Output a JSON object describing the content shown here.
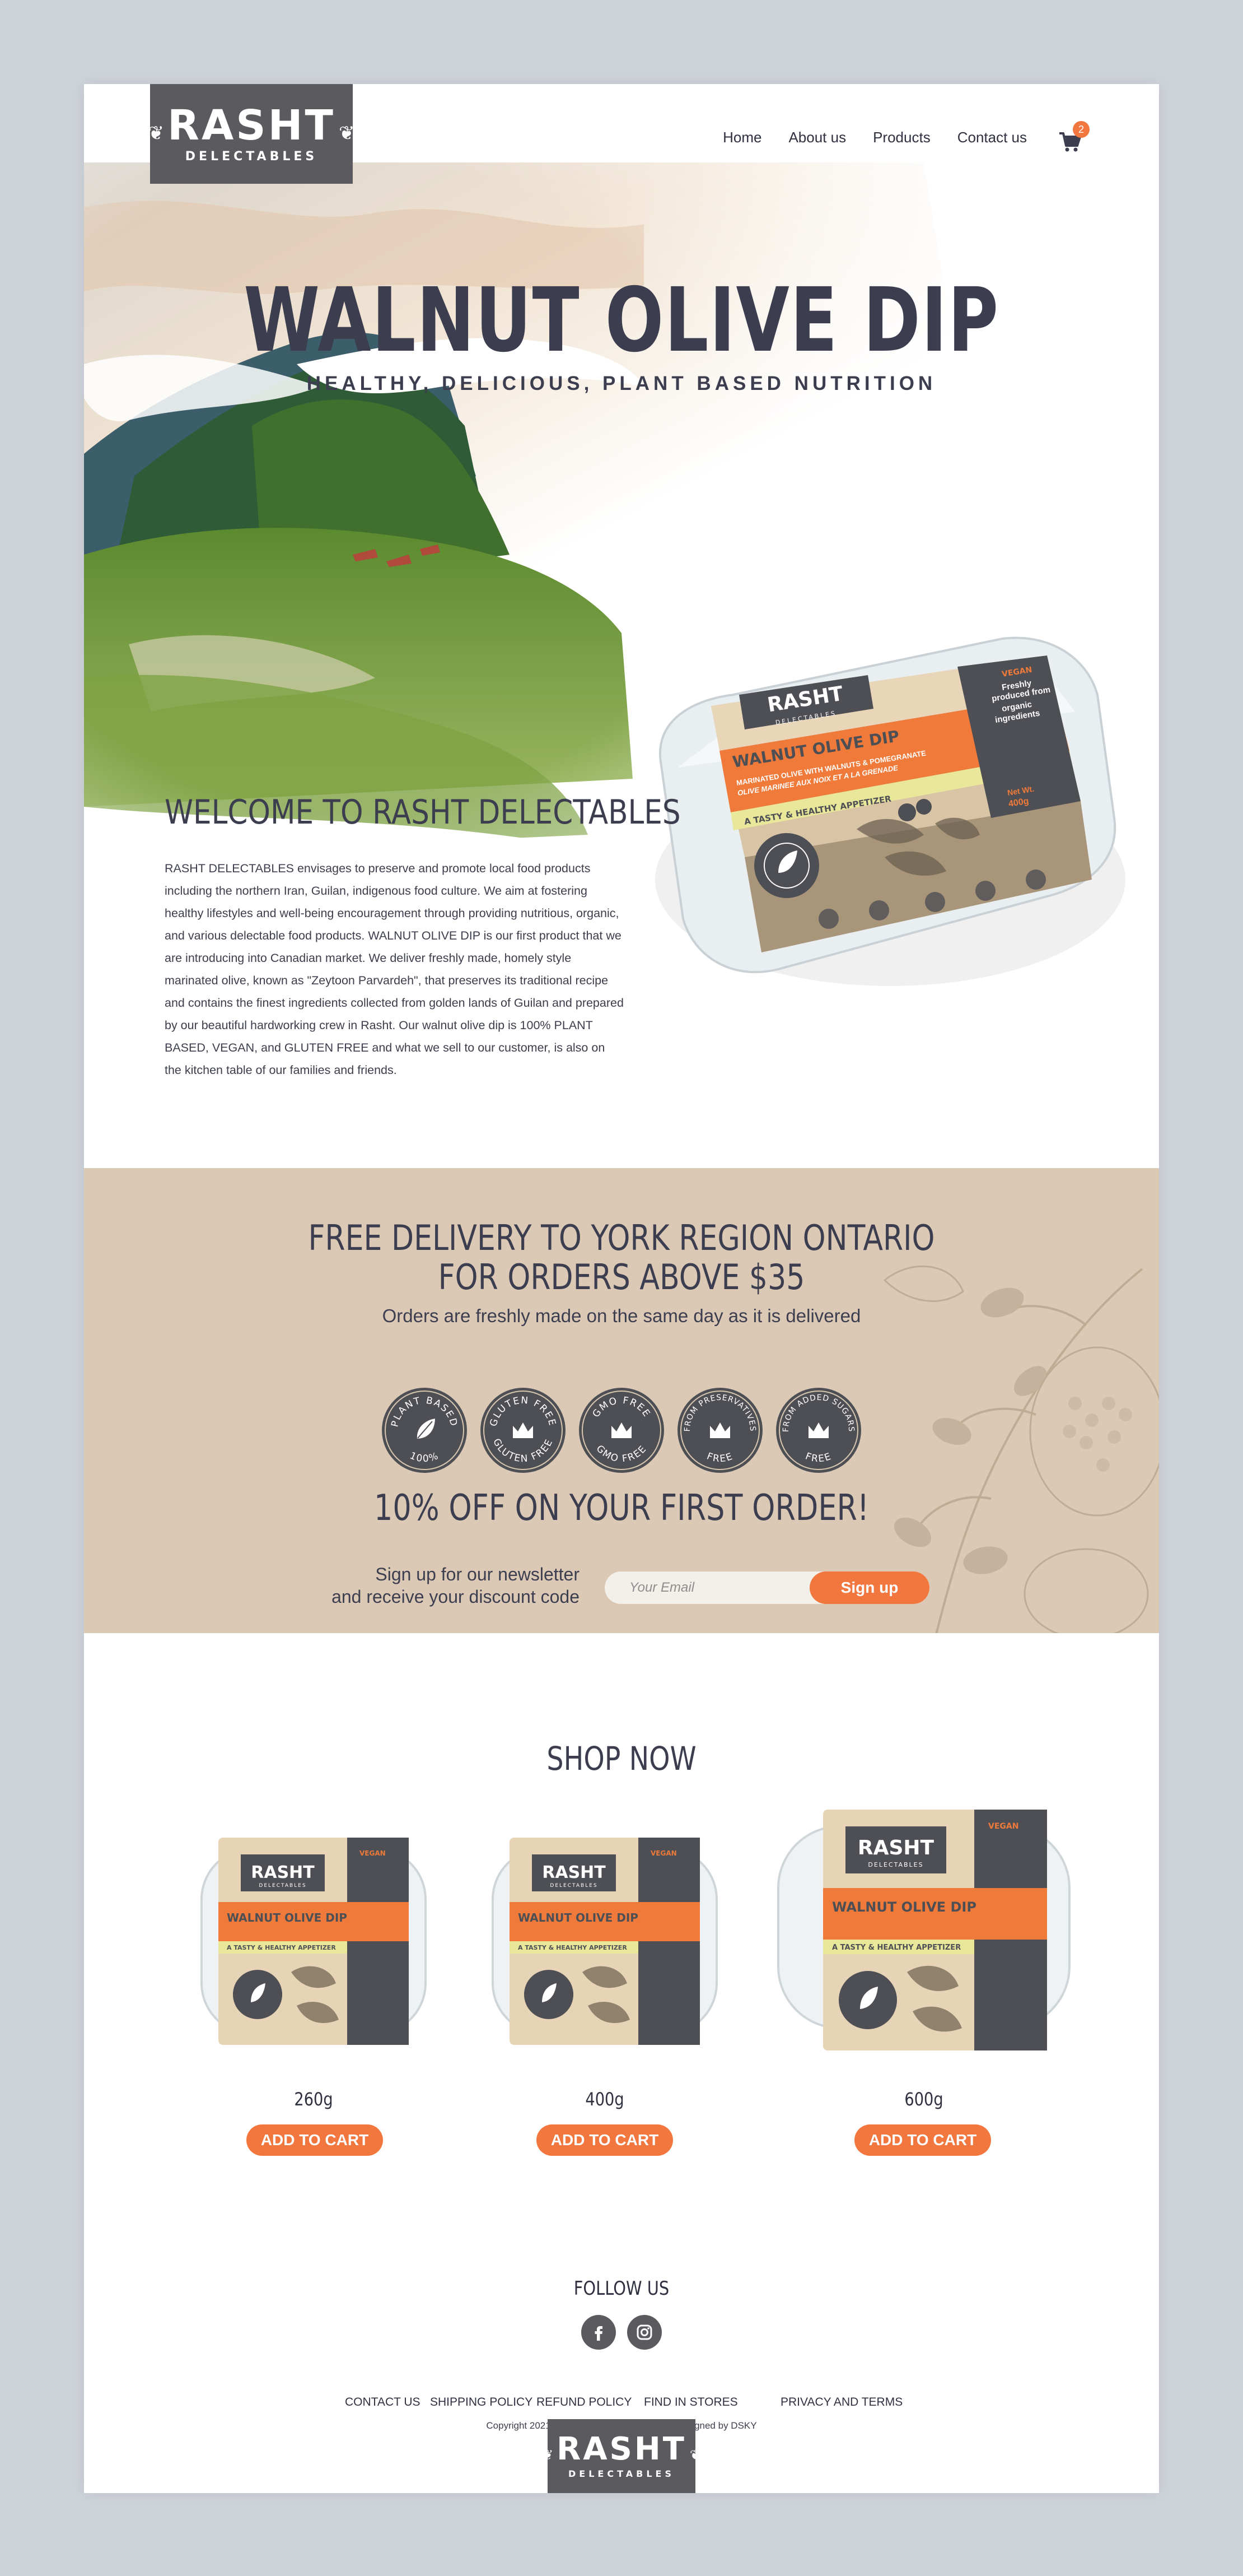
{
  "brand": {
    "logo_word": "RASHT",
    "logo_sub": "DELECTABLES"
  },
  "nav": {
    "items": [
      "Home",
      "About us",
      "Products",
      "Contact us"
    ],
    "cart_count": "2"
  },
  "hero": {
    "title": "WALNUT OLIVE DIP",
    "subtitle": "HEALTHY, DELICIOUS, PLANT BASED NUTRITION"
  },
  "package": {
    "brand": "RASHT",
    "brand_sub": "DELECTABLES",
    "vegan": "VEGAN",
    "tagline_1": "Freshly",
    "tagline_2": "produced from",
    "tagline_3": "organic",
    "tagline_4": "ingredients",
    "product": "WALNUT OLIVE DIP",
    "desc_1": "MARINATED OLIVE WITH WALNUTS & POMEGRANATE",
    "desc_2": "OLIVE MARINEE AUX NOIX ET A LA GRENADE",
    "appetizer": "A TASTY & HEALTHY APPETIZER",
    "net_wt": "Net Wt.",
    "weight": "400g"
  },
  "welcome": {
    "title": "WELCOME TO RASHT DELECTABLES",
    "body": "RASHT DELECTABLES envisages to preserve and promote local food products including the northern Iran, Guilan, indigenous food culture. We aim at fostering healthy lifestyles and well-being encouragement through providing nutritious, organic, and various delectable food products. WALNUT OLIVE DIP is our first product that we are introducing into Canadian market. We deliver freshly made, homely style marinated olive, known as \"Zeytoon Parvardeh\", that preserves its traditional recipe and contains the finest ingredients collected from golden lands of Guilan and prepared by our beautiful hardworking crew in Rasht. Our walnut olive dip is 100% PLANT BASED, VEGAN, and GLUTEN FREE and what we sell to our customer, is also on the kitchen table of our families and friends."
  },
  "promo": {
    "title_line1": "FREE DELIVERY TO YORK REGION ONTARIO",
    "title_line2": "FOR ORDERS ABOVE $35",
    "subtitle": "Orders are freshly made on the same day as it is delivered",
    "badges": [
      {
        "top": "PLANT BASED",
        "bottom": "100%",
        "icon": "leaf-icon"
      },
      {
        "top": "GLUTEN FREE",
        "bottom": "GLUTEN FREE",
        "icon": "crown-icon"
      },
      {
        "top": "GMO FREE",
        "bottom": "GMO FREE",
        "icon": "crown-icon"
      },
      {
        "top": "FROM PRESERVATIVES",
        "bottom": "FREE",
        "icon": "crown-icon"
      },
      {
        "top": "FROM ADDED SUGARS",
        "bottom": "FREE",
        "icon": "crown-icon"
      }
    ],
    "offer": "10% OFF ON YOUR FIRST ORDER!",
    "signup_line1": "Sign up for our newsletter",
    "signup_line2": "and receive your discount code",
    "email_placeholder": "Your Email",
    "signup_button": "Sign up"
  },
  "shop": {
    "title": "SHOP NOW",
    "products": [
      {
        "weight": "260g",
        "button": "ADD TO CART"
      },
      {
        "weight": "400g",
        "button": "ADD TO CART"
      },
      {
        "weight": "600g",
        "button": "ADD TO CART"
      }
    ]
  },
  "footer": {
    "follow": "FOLLOW US",
    "social_icons": [
      "facebook-icon",
      "instagram-icon"
    ],
    "links": [
      "CONTACT US",
      "SHIPPING POLICY",
      "REFUND POLICY",
      "FIND IN STORES",
      "PRIVACY AND TERMS"
    ],
    "copyright": "Copyright 2021 Rasht Delectables  |  Website Designed by DSKY"
  },
  "colors": {
    "accent": "#f2773f",
    "dark": "#3c3e50",
    "logo_bg": "#5a5a5f",
    "promo_bg": "#dbc9b6",
    "page_bg": "#ced2d9"
  }
}
